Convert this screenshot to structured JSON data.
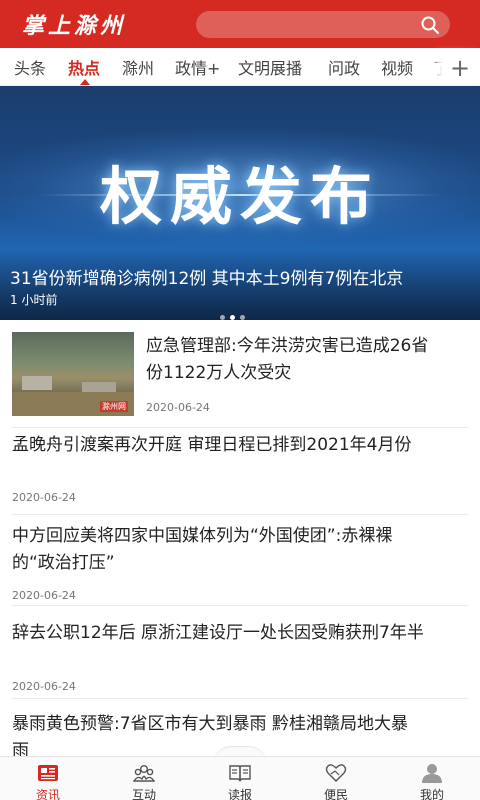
{
  "header": {
    "logo_text": "掌上滁州",
    "brand_color": "#d42a22",
    "search_icon": "search-icon"
  },
  "tabs": [
    {
      "label": "头条",
      "active": false
    },
    {
      "label": "热点",
      "active": true
    },
    {
      "label": "滁州",
      "active": false
    },
    {
      "label": "政情+",
      "active": false
    },
    {
      "label": "文明展播",
      "active": false
    },
    {
      "label": "问政",
      "active": false
    },
    {
      "label": "视频",
      "active": false
    },
    {
      "label": "了",
      "active": false
    }
  ],
  "tabs_more_icon": "plus-icon",
  "banner": {
    "image_text": "权威发布",
    "title": "31省份新增确诊病例12例 其中本土9例有7例在北京",
    "time": "1 小时前",
    "slide_count": 3,
    "active_slide": 2
  },
  "news": [
    {
      "title_line1": "应急管理部:今年洪涝灾害已造成26省",
      "title_line2": "份1122万人次受灾",
      "date": "2020-06-24",
      "has_image": true,
      "image_tag": "滁州网"
    },
    {
      "title_line1": "孟晚舟引渡案再次开庭 审理日程已排到2021年4月份",
      "title_line2": "",
      "date": "2020-06-24"
    },
    {
      "title_line1": "中方回应美将四家中国媒体列为“外国使团”:赤裸裸",
      "title_line2": "的“政治打压”",
      "date": "2020-06-24"
    },
    {
      "title_line1": "辞去公职12年后 原浙江建设厅一处长因受贿获刑7年半",
      "title_line2": "",
      "date": "2020-06-24"
    },
    {
      "title_line1": "暴雨黄色预警:7省区市有大到暴雨 黔桂湘赣局地大暴",
      "title_line2": "雨",
      "date": ""
    }
  ],
  "bottom_nav": [
    {
      "label": "资讯",
      "icon": "news-icon",
      "active": true
    },
    {
      "label": "互动",
      "icon": "people-icon",
      "active": false
    },
    {
      "label": "读报",
      "icon": "book-icon",
      "active": false
    },
    {
      "label": "便民",
      "icon": "handshake-icon",
      "active": false
    },
    {
      "label": "我的",
      "icon": "user-icon",
      "active": false
    }
  ]
}
